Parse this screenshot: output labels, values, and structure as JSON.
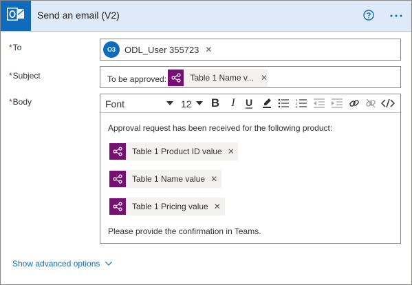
{
  "header": {
    "title": "Send an email (V2)",
    "help_icon": "help-circle-icon",
    "more_icon": "more-ellipsis-icon",
    "app_icon": "outlook-icon",
    "accent": "#0f6cbd",
    "background": "#dfeaf9"
  },
  "fields": {
    "required_mark": "*",
    "to": {
      "label": "To",
      "recipient_initials": "O3",
      "recipient_name": "ODL_User 355723"
    },
    "subject": {
      "label": "Subject",
      "prefix_text": "To be approved:",
      "token_label": "Table 1 Name v..."
    },
    "body": {
      "label": "Body",
      "toolbar": {
        "font_value": "Font",
        "size_value": "12",
        "buttons": [
          "bold",
          "italic",
          "underline",
          "highlight",
          "bulleted-list",
          "numbered-list",
          "decrease-indent",
          "increase-indent",
          "link",
          "unlink",
          "code-view"
        ]
      },
      "intro_text": "Approval request has been received for the following product:",
      "tokens": [
        "Table 1 Product ID value",
        "Table 1 Name value",
        "Table 1 Pricing value"
      ],
      "closing_text": "Please provide the confirmation in Teams."
    }
  },
  "footer": {
    "advanced_label": "Show advanced options"
  },
  "colors": {
    "token_icon_bg": "#770e73",
    "token_bg": "#f3f2f1",
    "required": "#a4262c",
    "link": "#0f6cbd"
  }
}
